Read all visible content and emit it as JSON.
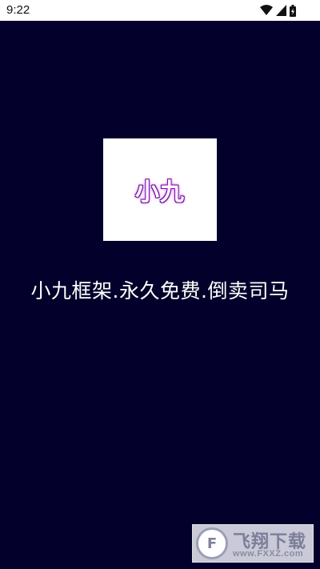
{
  "status_bar": {
    "time": "9:22",
    "icons": [
      "wifi-icon",
      "signal-icon",
      "battery-icon"
    ]
  },
  "logo": {
    "text": "小九"
  },
  "headline": "小九框架.永久免费.倒卖司马",
  "watermark": {
    "title": "飞翔下载",
    "url": "www.FXXZ.com",
    "emblem": "F"
  },
  "colors": {
    "background": "#03002b",
    "logo_card": "#ffffff",
    "text": "#ffffff"
  }
}
